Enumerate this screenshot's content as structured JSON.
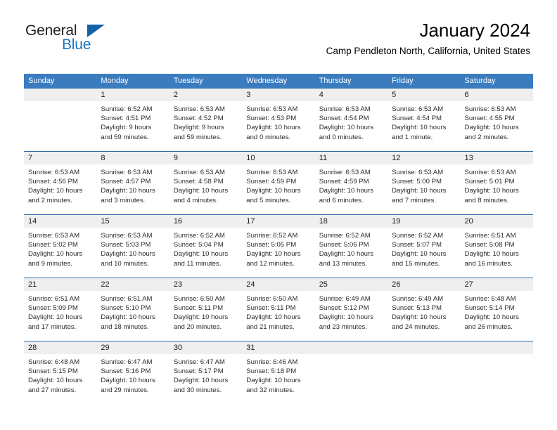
{
  "brand": {
    "name_top": "General",
    "name_bottom": "Blue",
    "triangle_color": "#1464a5",
    "blue_color": "#1b78c2"
  },
  "header": {
    "title": "January 2024",
    "subtitle": "Camp Pendleton North, California, United States",
    "header_bg": "#3b7cbf",
    "row_divider": "#2d6ca8",
    "daynum_bg": "#efefef"
  },
  "weekdays": [
    "Sunday",
    "Monday",
    "Tuesday",
    "Wednesday",
    "Thursday",
    "Friday",
    "Saturday"
  ],
  "weeks": [
    [
      {
        "day": "",
        "sunrise": "",
        "sunset": "",
        "daylight1": "",
        "daylight2": ""
      },
      {
        "day": "1",
        "sunrise": "Sunrise: 6:52 AM",
        "sunset": "Sunset: 4:51 PM",
        "daylight1": "Daylight: 9 hours",
        "daylight2": "and 59 minutes."
      },
      {
        "day": "2",
        "sunrise": "Sunrise: 6:53 AM",
        "sunset": "Sunset: 4:52 PM",
        "daylight1": "Daylight: 9 hours",
        "daylight2": "and 59 minutes."
      },
      {
        "day": "3",
        "sunrise": "Sunrise: 6:53 AM",
        "sunset": "Sunset: 4:53 PM",
        "daylight1": "Daylight: 10 hours",
        "daylight2": "and 0 minutes."
      },
      {
        "day": "4",
        "sunrise": "Sunrise: 6:53 AM",
        "sunset": "Sunset: 4:54 PM",
        "daylight1": "Daylight: 10 hours",
        "daylight2": "and 0 minutes."
      },
      {
        "day": "5",
        "sunrise": "Sunrise: 6:53 AM",
        "sunset": "Sunset: 4:54 PM",
        "daylight1": "Daylight: 10 hours",
        "daylight2": "and 1 minute."
      },
      {
        "day": "6",
        "sunrise": "Sunrise: 6:53 AM",
        "sunset": "Sunset: 4:55 PM",
        "daylight1": "Daylight: 10 hours",
        "daylight2": "and 2 minutes."
      }
    ],
    [
      {
        "day": "7",
        "sunrise": "Sunrise: 6:53 AM",
        "sunset": "Sunset: 4:56 PM",
        "daylight1": "Daylight: 10 hours",
        "daylight2": "and 2 minutes."
      },
      {
        "day": "8",
        "sunrise": "Sunrise: 6:53 AM",
        "sunset": "Sunset: 4:57 PM",
        "daylight1": "Daylight: 10 hours",
        "daylight2": "and 3 minutes."
      },
      {
        "day": "9",
        "sunrise": "Sunrise: 6:53 AM",
        "sunset": "Sunset: 4:58 PM",
        "daylight1": "Daylight: 10 hours",
        "daylight2": "and 4 minutes."
      },
      {
        "day": "10",
        "sunrise": "Sunrise: 6:53 AM",
        "sunset": "Sunset: 4:59 PM",
        "daylight1": "Daylight: 10 hours",
        "daylight2": "and 5 minutes."
      },
      {
        "day": "11",
        "sunrise": "Sunrise: 6:53 AM",
        "sunset": "Sunset: 4:59 PM",
        "daylight1": "Daylight: 10 hours",
        "daylight2": "and 6 minutes."
      },
      {
        "day": "12",
        "sunrise": "Sunrise: 6:53 AM",
        "sunset": "Sunset: 5:00 PM",
        "daylight1": "Daylight: 10 hours",
        "daylight2": "and 7 minutes."
      },
      {
        "day": "13",
        "sunrise": "Sunrise: 6:53 AM",
        "sunset": "Sunset: 5:01 PM",
        "daylight1": "Daylight: 10 hours",
        "daylight2": "and 8 minutes."
      }
    ],
    [
      {
        "day": "14",
        "sunrise": "Sunrise: 6:53 AM",
        "sunset": "Sunset: 5:02 PM",
        "daylight1": "Daylight: 10 hours",
        "daylight2": "and 9 minutes."
      },
      {
        "day": "15",
        "sunrise": "Sunrise: 6:53 AM",
        "sunset": "Sunset: 5:03 PM",
        "daylight1": "Daylight: 10 hours",
        "daylight2": "and 10 minutes."
      },
      {
        "day": "16",
        "sunrise": "Sunrise: 6:52 AM",
        "sunset": "Sunset: 5:04 PM",
        "daylight1": "Daylight: 10 hours",
        "daylight2": "and 11 minutes."
      },
      {
        "day": "17",
        "sunrise": "Sunrise: 6:52 AM",
        "sunset": "Sunset: 5:05 PM",
        "daylight1": "Daylight: 10 hours",
        "daylight2": "and 12 minutes."
      },
      {
        "day": "18",
        "sunrise": "Sunrise: 6:52 AM",
        "sunset": "Sunset: 5:06 PM",
        "daylight1": "Daylight: 10 hours",
        "daylight2": "and 13 minutes."
      },
      {
        "day": "19",
        "sunrise": "Sunrise: 6:52 AM",
        "sunset": "Sunset: 5:07 PM",
        "daylight1": "Daylight: 10 hours",
        "daylight2": "and 15 minutes."
      },
      {
        "day": "20",
        "sunrise": "Sunrise: 6:51 AM",
        "sunset": "Sunset: 5:08 PM",
        "daylight1": "Daylight: 10 hours",
        "daylight2": "and 16 minutes."
      }
    ],
    [
      {
        "day": "21",
        "sunrise": "Sunrise: 6:51 AM",
        "sunset": "Sunset: 5:09 PM",
        "daylight1": "Daylight: 10 hours",
        "daylight2": "and 17 minutes."
      },
      {
        "day": "22",
        "sunrise": "Sunrise: 6:51 AM",
        "sunset": "Sunset: 5:10 PM",
        "daylight1": "Daylight: 10 hours",
        "daylight2": "and 18 minutes."
      },
      {
        "day": "23",
        "sunrise": "Sunrise: 6:50 AM",
        "sunset": "Sunset: 5:11 PM",
        "daylight1": "Daylight: 10 hours",
        "daylight2": "and 20 minutes."
      },
      {
        "day": "24",
        "sunrise": "Sunrise: 6:50 AM",
        "sunset": "Sunset: 5:11 PM",
        "daylight1": "Daylight: 10 hours",
        "daylight2": "and 21 minutes."
      },
      {
        "day": "25",
        "sunrise": "Sunrise: 6:49 AM",
        "sunset": "Sunset: 5:12 PM",
        "daylight1": "Daylight: 10 hours",
        "daylight2": "and 23 minutes."
      },
      {
        "day": "26",
        "sunrise": "Sunrise: 6:49 AM",
        "sunset": "Sunset: 5:13 PM",
        "daylight1": "Daylight: 10 hours",
        "daylight2": "and 24 minutes."
      },
      {
        "day": "27",
        "sunrise": "Sunrise: 6:48 AM",
        "sunset": "Sunset: 5:14 PM",
        "daylight1": "Daylight: 10 hours",
        "daylight2": "and 26 minutes."
      }
    ],
    [
      {
        "day": "28",
        "sunrise": "Sunrise: 6:48 AM",
        "sunset": "Sunset: 5:15 PM",
        "daylight1": "Daylight: 10 hours",
        "daylight2": "and 27 minutes."
      },
      {
        "day": "29",
        "sunrise": "Sunrise: 6:47 AM",
        "sunset": "Sunset: 5:16 PM",
        "daylight1": "Daylight: 10 hours",
        "daylight2": "and 29 minutes."
      },
      {
        "day": "30",
        "sunrise": "Sunrise: 6:47 AM",
        "sunset": "Sunset: 5:17 PM",
        "daylight1": "Daylight: 10 hours",
        "daylight2": "and 30 minutes."
      },
      {
        "day": "31",
        "sunrise": "Sunrise: 6:46 AM",
        "sunset": "Sunset: 5:18 PM",
        "daylight1": "Daylight: 10 hours",
        "daylight2": "and 32 minutes."
      },
      {
        "day": "",
        "sunrise": "",
        "sunset": "",
        "daylight1": "",
        "daylight2": ""
      },
      {
        "day": "",
        "sunrise": "",
        "sunset": "",
        "daylight1": "",
        "daylight2": ""
      },
      {
        "day": "",
        "sunrise": "",
        "sunset": "",
        "daylight1": "",
        "daylight2": ""
      }
    ]
  ]
}
